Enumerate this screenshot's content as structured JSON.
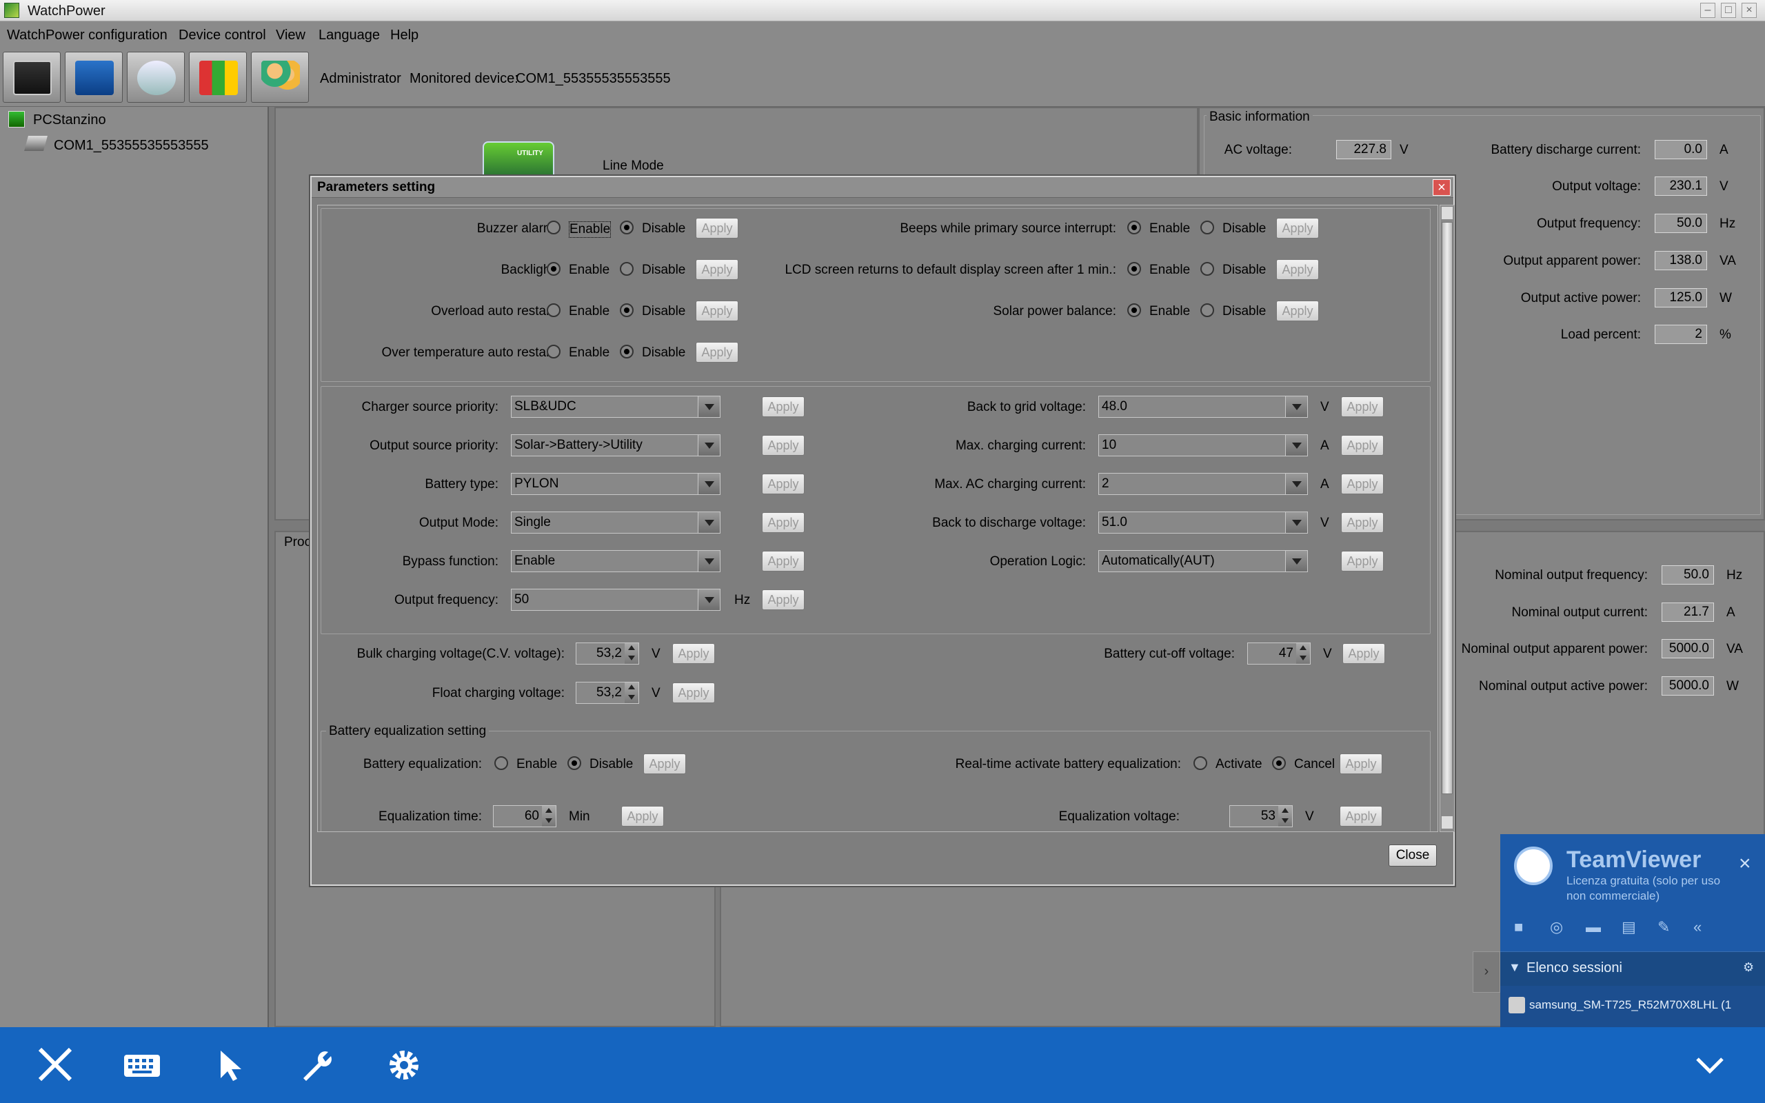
{
  "window": {
    "title": "WatchPower"
  },
  "menu": [
    "WatchPower configuration",
    "Device control",
    "View",
    "Language",
    "Help"
  ],
  "toolbar": {
    "user": "Administrator",
    "monitored_label": "Monitored device:",
    "monitored_device": "COM1_55355535553555"
  },
  "tree": {
    "root": "PCStanzino",
    "device": "COM1_55355535553555"
  },
  "mode": {
    "label": "Line Mode",
    "icon_text": "UTILITY"
  },
  "proc_label": "Proc",
  "basic_info": {
    "title": "Basic information",
    "ac_voltage": {
      "label": "AC voltage:",
      "value": "227.8",
      "unit": "V"
    },
    "rows": [
      {
        "label": "Battery discharge current:",
        "value": "0.0",
        "unit": "A"
      },
      {
        "label": "Output voltage:",
        "value": "230.1",
        "unit": "V"
      },
      {
        "label": "Output frequency:",
        "value": "50.0",
        "unit": "Hz"
      },
      {
        "label": "Output apparent power:",
        "value": "138.0",
        "unit": "VA"
      },
      {
        "label": "Output active power:",
        "value": "125.0",
        "unit": "W"
      },
      {
        "label": "Load percent:",
        "value": "2",
        "unit": "%"
      }
    ]
  },
  "nominal": [
    {
      "label": "Nominal output frequency:",
      "value": "50.0",
      "unit": "Hz"
    },
    {
      "label": "Nominal output current:",
      "value": "21.7",
      "unit": "A"
    },
    {
      "label": "Nominal output apparent power:",
      "value": "5000.0",
      "unit": "VA"
    },
    {
      "label": "Nominal output active power:",
      "value": "5000.0",
      "unit": "W"
    }
  ],
  "dialog": {
    "title": "Parameters setting",
    "apply": "Apply",
    "enable": "Enable",
    "disable": "Disable",
    "activate": "Activate",
    "cancel": "Cancel",
    "close": "Close",
    "toggles_left": [
      {
        "label": "Buzzer alarm:",
        "selected": "Disable"
      },
      {
        "label": "Backlight:",
        "selected": "Enable"
      },
      {
        "label": "Overload auto restart:",
        "selected": "Disable"
      },
      {
        "label": "Over temperature auto restart:",
        "selected": "Disable"
      }
    ],
    "toggles_right": [
      {
        "label": "Beeps while primary source interrupt:",
        "selected": "Enable"
      },
      {
        "label": "LCD screen returns to default display screen after 1 min.:",
        "selected": "Enable"
      },
      {
        "label": "Solar power balance:",
        "selected": "Enable"
      }
    ],
    "combos_left": [
      {
        "label": "Charger source priority:",
        "value": "SLB&UDC",
        "unit": ""
      },
      {
        "label": "Output source priority:",
        "value": "Solar->Battery->Utility",
        "unit": ""
      },
      {
        "label": "Battery type:",
        "value": "PYLON",
        "unit": ""
      },
      {
        "label": "Output Mode:",
        "value": "Single",
        "unit": ""
      },
      {
        "label": "Bypass function:",
        "value": "Enable",
        "unit": ""
      },
      {
        "label": "Output frequency:",
        "value": "50",
        "unit": "Hz"
      }
    ],
    "combos_right": [
      {
        "label": "Back to grid voltage:",
        "value": "48.0",
        "unit": "V"
      },
      {
        "label": "Max. charging current:",
        "value": "10",
        "unit": "A"
      },
      {
        "label": "Max. AC charging current:",
        "value": "2",
        "unit": "A"
      },
      {
        "label": "Back to discharge voltage:",
        "value": "51.0",
        "unit": "V"
      },
      {
        "label": "Operation Logic:",
        "value": "Automatically(AUT)",
        "unit": ""
      }
    ],
    "bulk": {
      "label": "Bulk charging voltage(C.V. voltage):",
      "value": "53,2",
      "unit": "V"
    },
    "float": {
      "label": "Float charging voltage:",
      "value": "53,2",
      "unit": "V"
    },
    "cutoff": {
      "label": "Battery cut-off voltage:",
      "value": "47",
      "unit": "V"
    },
    "eq_section": "Battery equalization setting",
    "eq": {
      "label": "Battery equalization:",
      "selected": "Disable"
    },
    "rt_eq": {
      "label": "Real-time activate battery equalization:",
      "selected": "Cancel"
    },
    "eq_time": {
      "label": "Equalization time:",
      "value": "60",
      "unit": "Min"
    },
    "eq_voltage": {
      "label": "Equalization voltage:",
      "value": "53",
      "unit": "V"
    }
  },
  "teamviewer": {
    "brand": "TeamViewer",
    "subtitle1": "Licenza gratuita (solo per uso",
    "subtitle2": "non commerciale)",
    "sessions": "Elenco sessioni",
    "session_item": "samsung_SM-T725_R52M70X8LHL (1"
  },
  "colors": {
    "taskbar": "#1565c0",
    "teamviewer": "#1d5aa8",
    "close_red": "#d9534f"
  }
}
